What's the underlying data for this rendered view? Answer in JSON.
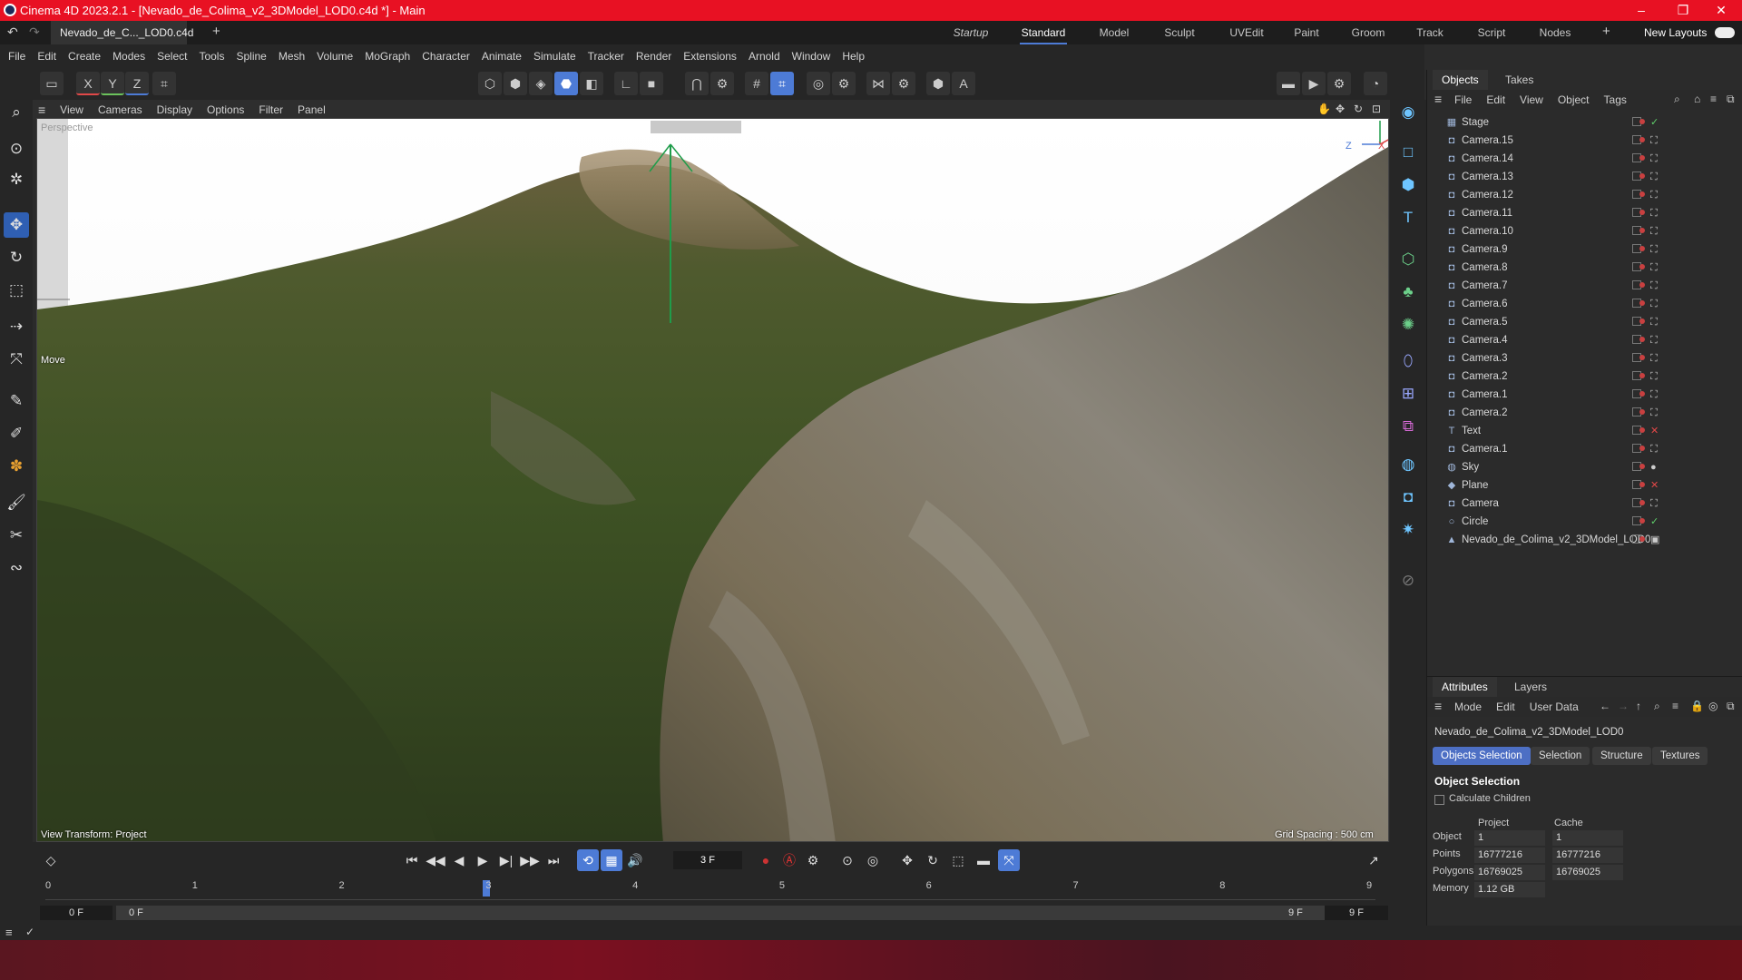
{
  "title_bar": {
    "title": "Cinema 4D 2023.2.1 - [Nevado_de_Colima_v2_3DModel_LOD0.c4d *] - Main",
    "controls": [
      "–",
      "❐",
      "✕"
    ]
  },
  "document_tab": {
    "label": "Nevado_de_C..._LOD0.c4d *",
    "add": "+"
  },
  "layouts": [
    "Startup",
    "Standard",
    "Model",
    "Sculpt",
    "UVEdit",
    "Paint",
    "Groom",
    "Track",
    "Script",
    "Nodes"
  ],
  "layouts_active": "Standard",
  "new_layouts_label": "New Layouts",
  "menu": [
    "File",
    "Edit",
    "Create",
    "Modes",
    "Select",
    "Tools",
    "Spline",
    "Mesh",
    "Volume",
    "MoGraph",
    "Character",
    "Animate",
    "Simulate",
    "Tracker",
    "Render",
    "Extensions",
    "Arnold",
    "Window",
    "Help"
  ],
  "axis_buttons": [
    "X",
    "Y",
    "Z"
  ],
  "viewport": {
    "menu": [
      "View",
      "Cameras",
      "Display",
      "Options",
      "Filter",
      "Panel"
    ],
    "camera_label": "Perspective",
    "mode_label": "Move",
    "view_transform": "View Transform: Project",
    "grid_spacing": "Grid Spacing : 500 cm",
    "axis_z": "Z",
    "axis_x": "X"
  },
  "timeline": {
    "current_frame": "3 F",
    "ticks": [
      "0",
      "1",
      "2",
      "3",
      "4",
      "5",
      "6",
      "7",
      "8",
      "9"
    ],
    "playhead_frame": 3,
    "max_frame": 9,
    "start_field": "0 F",
    "range_start": "0 F",
    "range_end": "9 F",
    "end_field": "9 F"
  },
  "objects_panel": {
    "tabs": [
      "Objects",
      "Takes"
    ],
    "menu": [
      "File",
      "Edit",
      "View",
      "Object",
      "Tags"
    ],
    "items": [
      {
        "name": "Stage",
        "icon": "stage-icon",
        "tag": "✓"
      },
      {
        "name": "Camera.15",
        "icon": "camera-icon",
        "tag": "⛶"
      },
      {
        "name": "Camera.14",
        "icon": "camera-icon",
        "tag": "⛶"
      },
      {
        "name": "Camera.13",
        "icon": "camera-icon",
        "tag": "⛶"
      },
      {
        "name": "Camera.12",
        "icon": "camera-icon",
        "tag": "⛶"
      },
      {
        "name": "Camera.11",
        "icon": "camera-icon",
        "tag": "⛶"
      },
      {
        "name": "Camera.10",
        "icon": "camera-icon",
        "tag": "⛶"
      },
      {
        "name": "Camera.9",
        "icon": "camera-icon",
        "tag": "⛶"
      },
      {
        "name": "Camera.8",
        "icon": "camera-icon",
        "tag": "⛶"
      },
      {
        "name": "Camera.7",
        "icon": "camera-icon",
        "tag": "⛶"
      },
      {
        "name": "Camera.6",
        "icon": "camera-icon",
        "tag": "⛶"
      },
      {
        "name": "Camera.5",
        "icon": "camera-icon",
        "tag": "⛶"
      },
      {
        "name": "Camera.4",
        "icon": "camera-icon",
        "tag": "⛶"
      },
      {
        "name": "Camera.3",
        "icon": "camera-icon",
        "tag": "⛶"
      },
      {
        "name": "Camera.2",
        "icon": "camera-icon",
        "tag": "⛶"
      },
      {
        "name": "Camera.1",
        "icon": "camera-icon",
        "tag": "⛶"
      },
      {
        "name": "Camera.2",
        "icon": "camera-icon",
        "tag": "⛶"
      },
      {
        "name": "Text",
        "icon": "text-icon",
        "tag": "✕"
      },
      {
        "name": "Camera.1",
        "icon": "camera-icon",
        "tag": "⛶"
      },
      {
        "name": "Sky",
        "icon": "sky-icon",
        "tag": "●"
      },
      {
        "name": "Plane",
        "icon": "plane-icon",
        "tag": "✕"
      },
      {
        "name": "Camera",
        "icon": "camera-icon",
        "tag": "⛶"
      },
      {
        "name": "Circle",
        "icon": "circle-icon",
        "tag": "✓"
      },
      {
        "name": "Nevado_de_Colima_v2_3DModel_LOD0",
        "icon": "polygon-icon",
        "tag": "▣"
      }
    ]
  },
  "attributes_panel": {
    "tabs": [
      "Attributes",
      "Layers"
    ],
    "menu": [
      "Mode",
      "Edit",
      "User Data"
    ],
    "object_name": "Nevado_de_Colima_v2_3DModel_LOD0",
    "buttons": [
      "Objects Selection",
      "Selection",
      "Structure",
      "Textures"
    ],
    "section_title": "Object Selection",
    "calc_children": "Calculate Children",
    "col_project": "Project",
    "col_cache": "Cache",
    "rows": [
      {
        "label": "Object",
        "project": "1",
        "cache": "1"
      },
      {
        "label": "Points",
        "project": "16777216",
        "cache": "16777216"
      },
      {
        "label": "Polygons",
        "project": "16769025",
        "cache": "16769025"
      },
      {
        "label": "Memory",
        "project": "1.12 GB",
        "cache": ""
      }
    ]
  },
  "colors": {
    "accent": "#4d7bd6",
    "titlebar": "#e81123"
  }
}
